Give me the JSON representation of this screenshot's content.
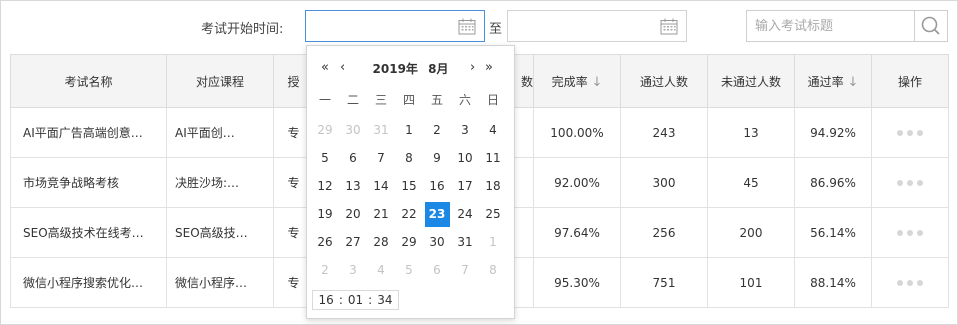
{
  "filter": {
    "label": "考试开始时间:",
    "to_label": "至",
    "search_placeholder": "输入考试标题"
  },
  "table": {
    "headers": {
      "name": "考试名称",
      "course": "对应课程",
      "col3": "授",
      "col4": "数",
      "completion": "完成率",
      "passed": "通过人数",
      "failed": "未通过人数",
      "pass_rate": "通过率",
      "actions": "操作"
    },
    "rows": [
      {
        "name": "AI平面广告高端创意…",
        "course": "AI平面创…",
        "col3": "专",
        "completion": "100.00%",
        "passed": "243",
        "failed": "13",
        "pass_rate": "94.92%"
      },
      {
        "name": "市场竞争战略考核",
        "course": "决胜沙场:…",
        "col3": "专",
        "completion": "92.00%",
        "passed": "300",
        "failed": "45",
        "pass_rate": "86.96%"
      },
      {
        "name": "SEO高级技术在线考…",
        "course": "SEO高级技…",
        "col3": "专",
        "completion": "97.64%",
        "passed": "256",
        "failed": "200",
        "pass_rate": "56.14%"
      },
      {
        "name": "微信小程序搜索优化…",
        "course": "微信小程序…",
        "col3": "专",
        "completion": "95.30%",
        "passed": "751",
        "failed": "101",
        "pass_rate": "88.14%"
      }
    ]
  },
  "picker": {
    "prev_year": "«",
    "prev_month": "‹",
    "next_month": "›",
    "next_year": "»",
    "year": "2019年",
    "month": "8月",
    "weekdays": [
      "一",
      "二",
      "三",
      "四",
      "五",
      "六",
      "日"
    ],
    "days": [
      {
        "d": "29",
        "o": true
      },
      {
        "d": "30",
        "o": true
      },
      {
        "d": "31",
        "o": true
      },
      {
        "d": "1"
      },
      {
        "d": "2"
      },
      {
        "d": "3"
      },
      {
        "d": "4"
      },
      {
        "d": "5"
      },
      {
        "d": "6"
      },
      {
        "d": "7"
      },
      {
        "d": "8"
      },
      {
        "d": "9"
      },
      {
        "d": "10"
      },
      {
        "d": "11"
      },
      {
        "d": "12"
      },
      {
        "d": "13"
      },
      {
        "d": "14"
      },
      {
        "d": "15"
      },
      {
        "d": "16"
      },
      {
        "d": "17"
      },
      {
        "d": "18"
      },
      {
        "d": "19"
      },
      {
        "d": "20"
      },
      {
        "d": "21"
      },
      {
        "d": "22"
      },
      {
        "d": "23",
        "s": true
      },
      {
        "d": "24"
      },
      {
        "d": "25"
      },
      {
        "d": "26"
      },
      {
        "d": "27"
      },
      {
        "d": "28"
      },
      {
        "d": "29"
      },
      {
        "d": "30"
      },
      {
        "d": "31"
      },
      {
        "d": "1",
        "o": true
      },
      {
        "d": "2",
        "o": true
      },
      {
        "d": "3",
        "o": true
      },
      {
        "d": "4",
        "o": true
      },
      {
        "d": "5",
        "o": true
      },
      {
        "d": "6",
        "o": true
      },
      {
        "d": "7",
        "o": true
      },
      {
        "d": "8",
        "o": true
      }
    ],
    "time": {
      "h": "16",
      "m": "01",
      "s": "34",
      "sep": ":"
    }
  },
  "colors": {
    "accent": "#1c88e5",
    "active_border": "#4a90d9"
  },
  "icons": {
    "calendar": "calendar-icon",
    "search": "search-icon",
    "more": "more-dots-icon"
  }
}
